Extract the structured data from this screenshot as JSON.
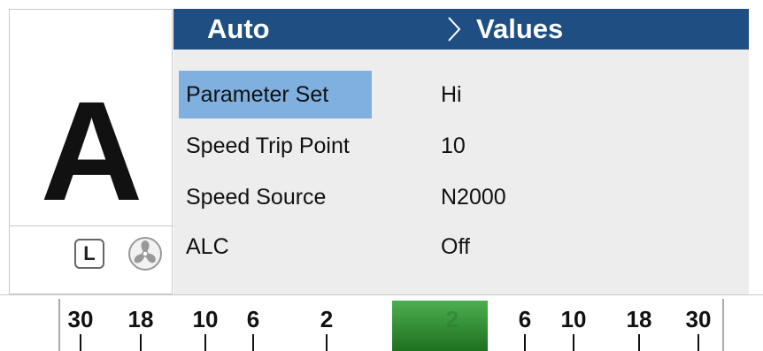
{
  "mode": {
    "letter": "A",
    "local_badge": "L"
  },
  "icons": {
    "local": "local-badge-icon",
    "fan": "fan-icon",
    "chevron": "chevron-right-icon"
  },
  "header": {
    "left": "Auto",
    "right": "Values"
  },
  "rows": [
    {
      "label": "Parameter Set",
      "value": "Hi",
      "selected": true
    },
    {
      "label": "Speed Trip Point",
      "value": "10"
    },
    {
      "label": "Speed Source",
      "value": "N2000"
    },
    {
      "label": "ALC",
      "value": "Off"
    }
  ],
  "scale": {
    "left_ticks": [
      "30",
      "18",
      "10",
      "6",
      "2"
    ],
    "center": "2",
    "right_ticks": [
      "6",
      "10",
      "18",
      "30"
    ]
  },
  "colors": {
    "header_bg": "#1f4f82",
    "selected_bg": "#7fb0e0",
    "panel_bg": "#ededed",
    "indicator": "#2e8b2e"
  }
}
